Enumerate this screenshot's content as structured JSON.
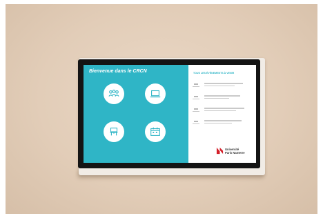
{
  "screen": {
    "welcome_title": "Bienvenue dans le CRCN",
    "tiles": [
      {
        "icon": "people-icon"
      },
      {
        "icon": "laptop-icon"
      },
      {
        "icon": "chair-icon"
      },
      {
        "icon": "calendar-icon"
      }
    ],
    "events_title": "TOUS LES ÉVÉNEMENTS À VENIR",
    "logo": {
      "line1": "Université",
      "line2": "Paris Nanterre"
    }
  },
  "colors": {
    "accent": "#2fb5c6",
    "wall": "#e2cdb8",
    "logo_red": "#d3202a"
  }
}
